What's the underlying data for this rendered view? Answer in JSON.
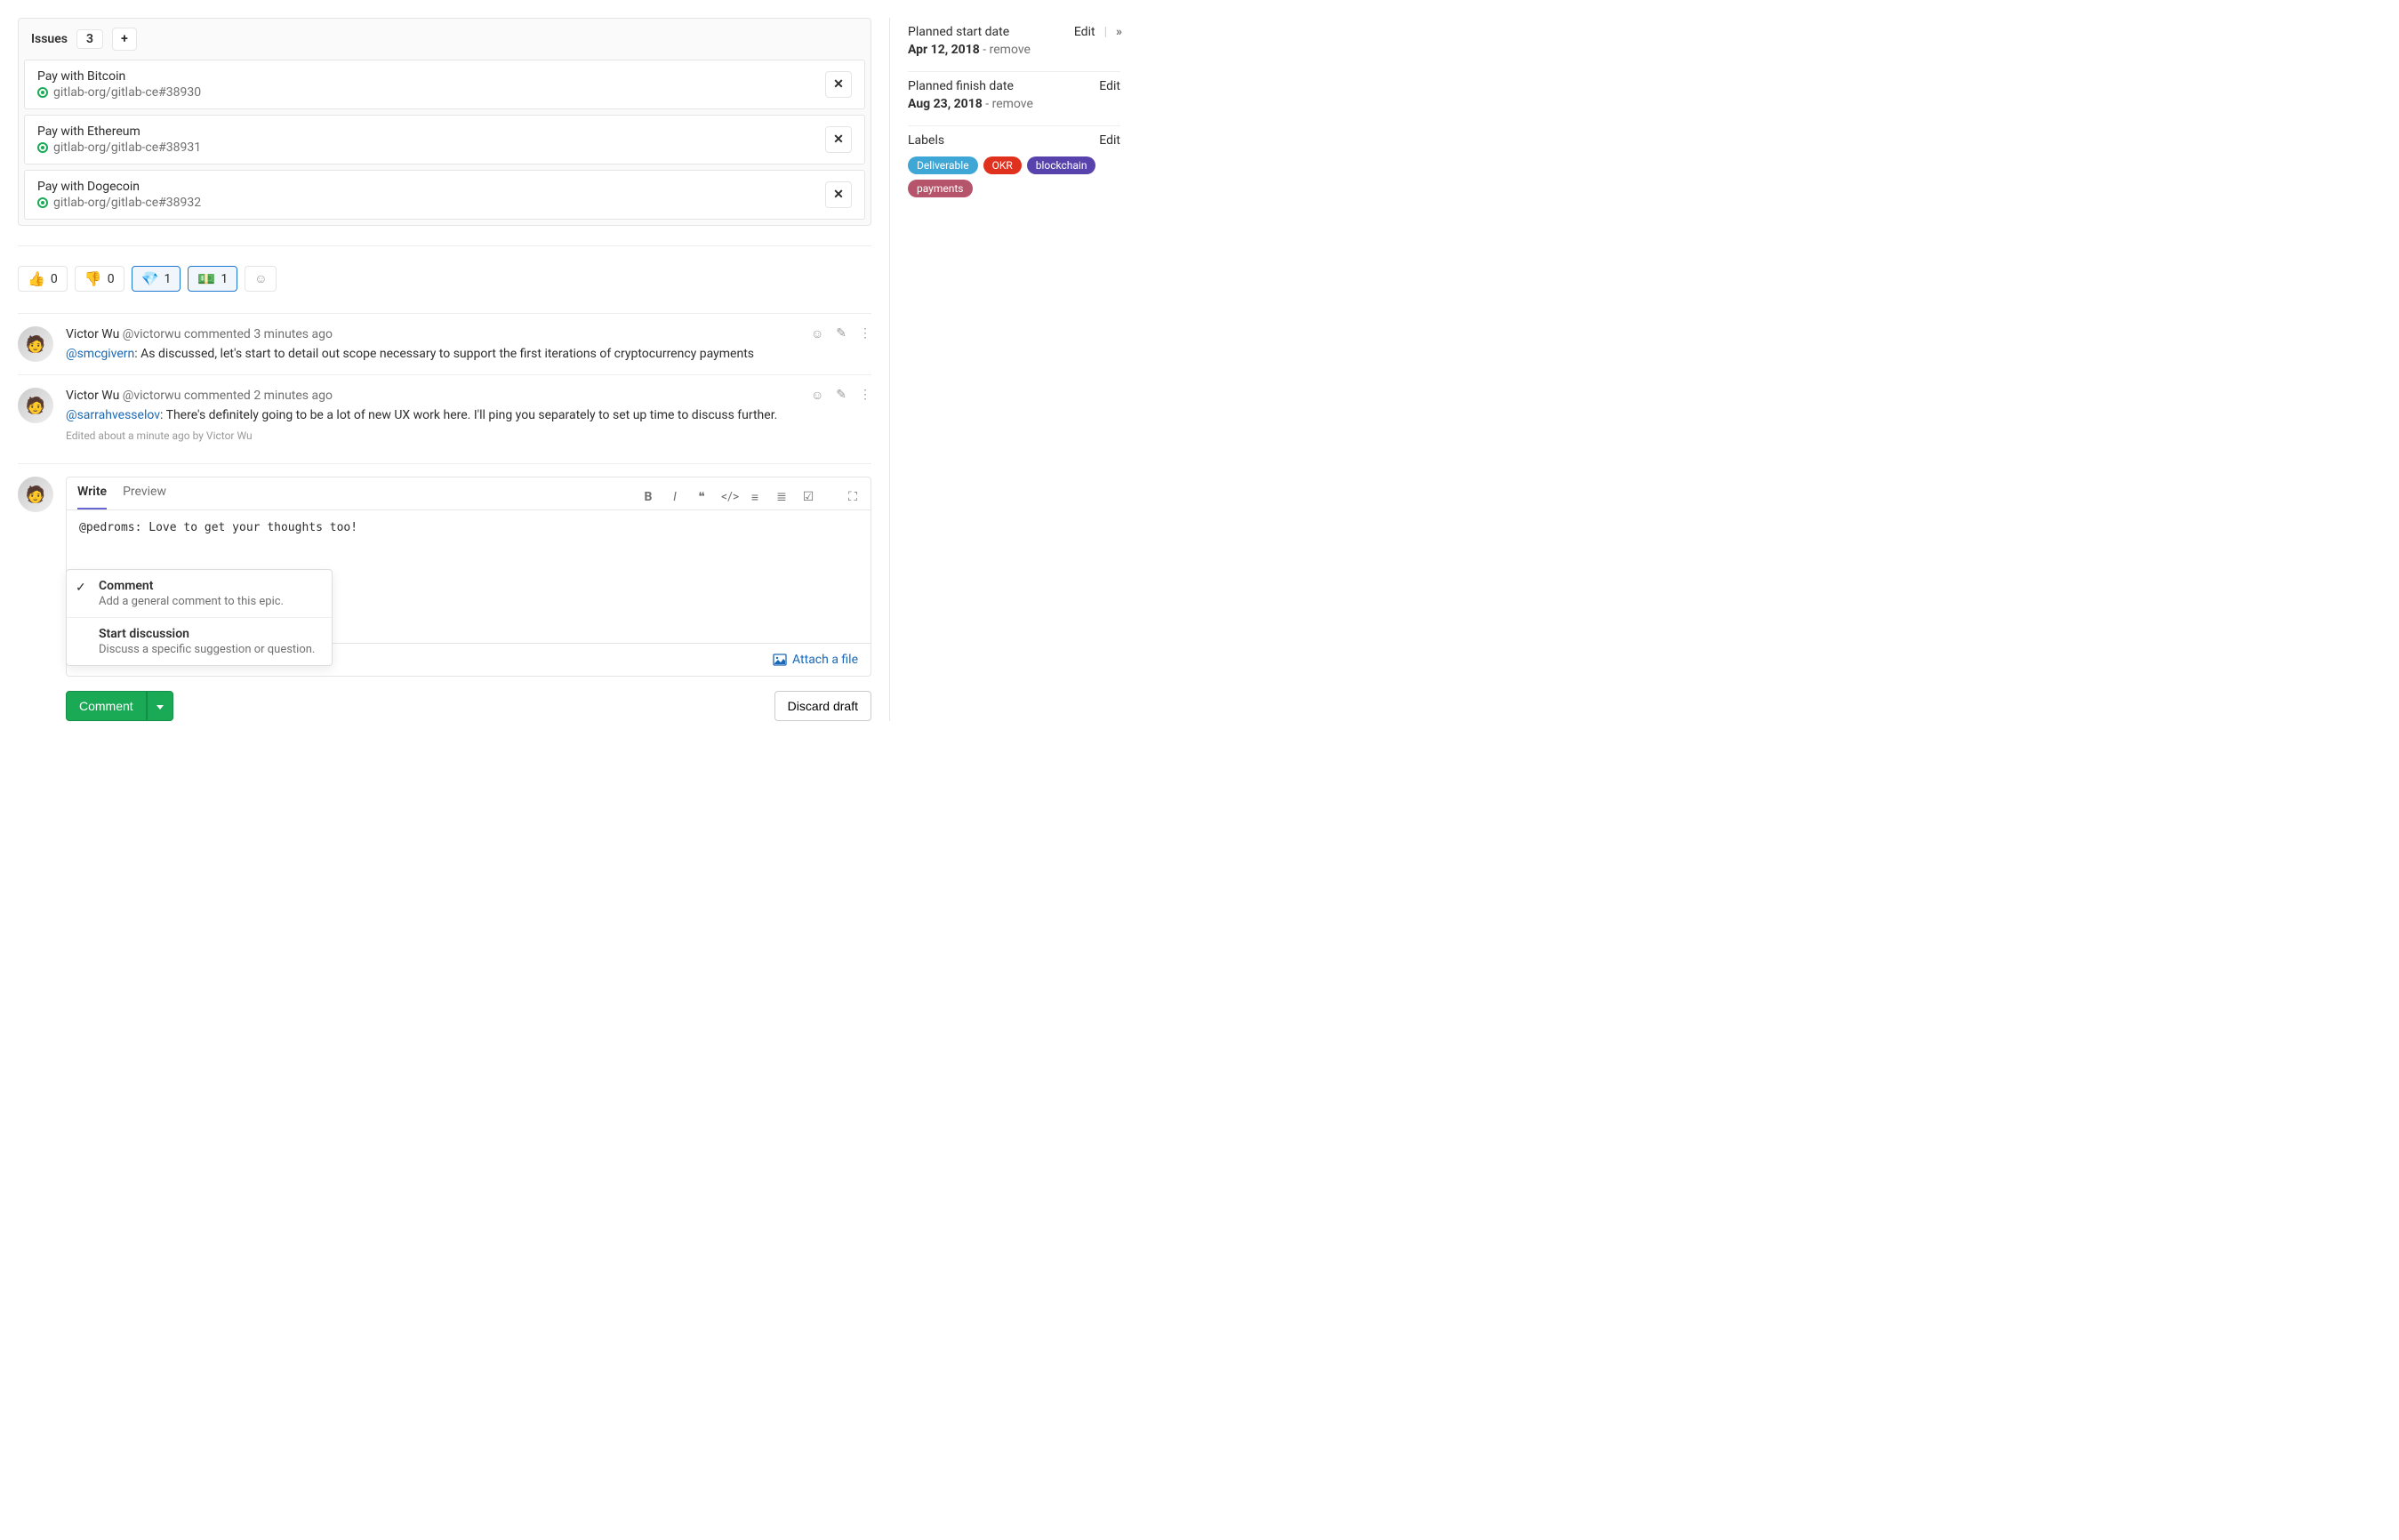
{
  "issues": {
    "header_title": "Issues",
    "count": "3",
    "items": [
      {
        "title": "Pay with Bitcoin",
        "ref": "gitlab-org/gitlab-ce#38930"
      },
      {
        "title": "Pay with Ethereum",
        "ref": "gitlab-org/gitlab-ce#38931"
      },
      {
        "title": "Pay with Dogecoin",
        "ref": "gitlab-org/gitlab-ce#38932"
      }
    ]
  },
  "reactions": {
    "thumbs_up": {
      "emoji": "👍",
      "count": "0"
    },
    "thumbs_down": {
      "emoji": "👎",
      "count": "0"
    },
    "diamond": {
      "emoji": "💎",
      "count": "1"
    },
    "money": {
      "emoji": "💵",
      "count": "1"
    }
  },
  "notes": [
    {
      "author_name": "Victor Wu",
      "author_handle": "@victorwu",
      "action": "commented",
      "time": "3 minutes ago",
      "mention": "@smcgivern",
      "sep": ": ",
      "text": "As discussed, let's start to detail out scope necessary to support the first iterations of cryptocurrency payments",
      "edited": ""
    },
    {
      "author_name": "Victor Wu",
      "author_handle": "@victorwu",
      "action": "commented",
      "time": "2 minutes ago",
      "mention": "@sarrahvesselov",
      "sep": ": ",
      "text": "There's definitely going to be a lot of new UX work here. I'll ping you separately to set up time to discuss further.",
      "edited": "Edited about a minute ago by Victor Wu"
    }
  ],
  "editor": {
    "tab_write": "Write",
    "tab_preview": "Preview",
    "content": "@pedroms: Love to get your thoughts too!",
    "attach_label": "Attach a file"
  },
  "dropdown": {
    "comment_title": "Comment",
    "comment_desc": "Add a general comment to this epic.",
    "discussion_title": "Start discussion",
    "discussion_desc": "Discuss a specific suggestion or question."
  },
  "actions": {
    "comment_button": "Comment",
    "discard_button": "Discard draft"
  },
  "sidebar": {
    "start": {
      "label": "Planned start date",
      "edit": "Edit",
      "date": "Apr 12, 2018",
      "sep": " - ",
      "remove": "remove"
    },
    "finish": {
      "label": "Planned finish date",
      "edit": "Edit",
      "date": "Aug 23, 2018",
      "sep": " - ",
      "remove": "remove"
    },
    "labels": {
      "label": "Labels",
      "edit": "Edit"
    },
    "label_items": {
      "deliverable": "Deliverable",
      "okr": "OKR",
      "blockchain": "blockchain",
      "payments": "payments"
    }
  }
}
